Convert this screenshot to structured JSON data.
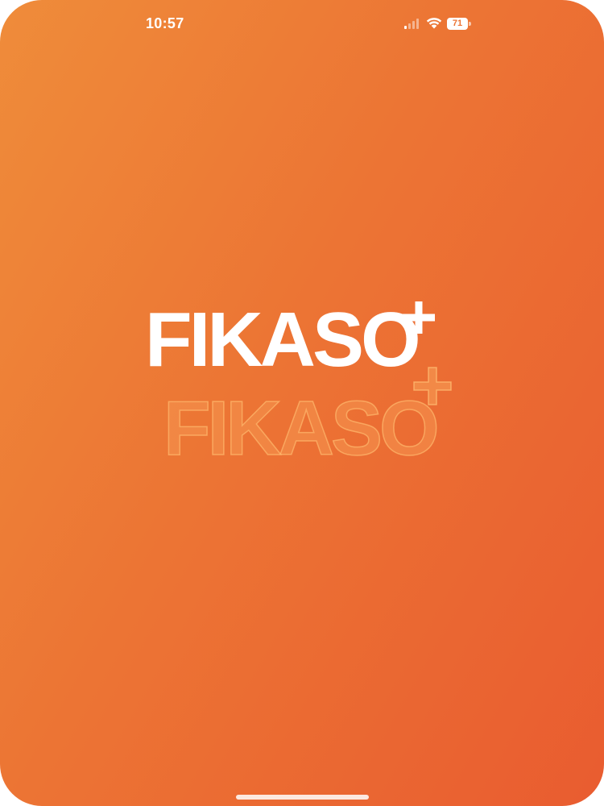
{
  "status_bar": {
    "time": "10:57",
    "signal_icon": "cellular-signal-icon",
    "wifi_icon": "wifi-icon",
    "battery_icon": "battery-icon",
    "battery_level": "71"
  },
  "splash": {
    "logo_text": "FIKASO",
    "logo_plus": "+",
    "ghost_logo_text": "FIKASO",
    "ghost_logo_plus": "+",
    "logo_name": "fikaso-plus-logo"
  },
  "colors": {
    "gradient_start": "#ef8c3a",
    "gradient_end": "#e95c30",
    "logo": "#ffffff"
  }
}
